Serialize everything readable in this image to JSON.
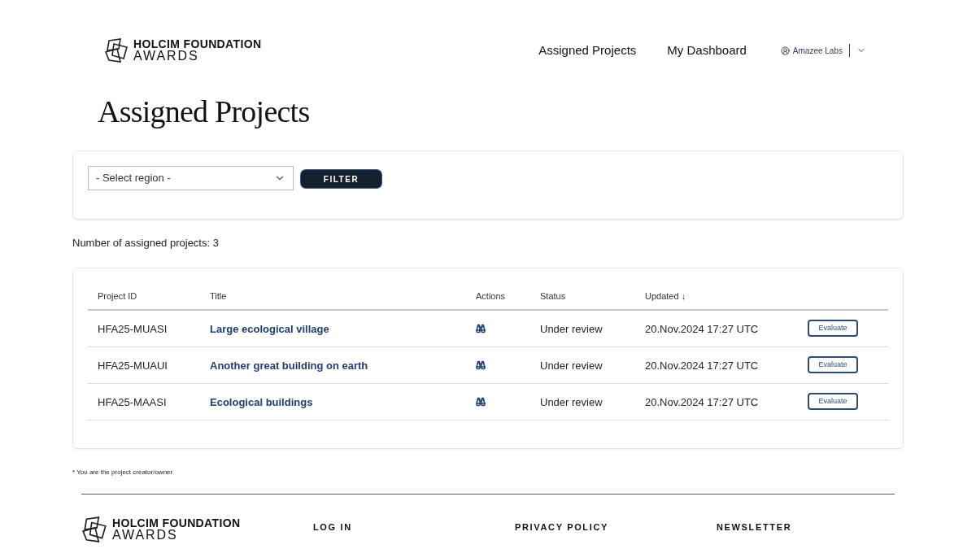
{
  "header": {
    "logo": {
      "line1": "HOLCIM FOUNDATION",
      "line2": "AWARDS"
    },
    "nav": [
      "Assigned Projects",
      "My Dashboard"
    ],
    "user": "Amazee Labs"
  },
  "page_title": "Assigned Projects",
  "filter": {
    "select_placeholder": "- Select region -",
    "button": "FILTER"
  },
  "count_text": "Number of assigned projects: 3",
  "table": {
    "columns": [
      {
        "label": "Project ID"
      },
      {
        "label": "Title"
      },
      {
        "label": "Actions"
      },
      {
        "label": "Status"
      },
      {
        "label": "Updated",
        "sort": "↓"
      }
    ],
    "rows": [
      {
        "id": "HFA25-MUASI",
        "title": "Large ecological village",
        "status": "Under review",
        "updated": "20.Nov.2024 17:27 UTC",
        "action": "Evaluate"
      },
      {
        "id": "HFA25-MUAUI",
        "title": "Another great building on earth",
        "status": "Under review",
        "updated": "20.Nov.2024 17:27 UTC",
        "action": "Evaluate"
      },
      {
        "id": "HFA25-MAASI",
        "title": "Ecological buildings",
        "status": "Under review",
        "updated": "20.Nov.2024 17:27 UTC",
        "action": "Evaluate"
      }
    ]
  },
  "footnote": "* You are the project creator/owner",
  "footer": {
    "logo": {
      "line1": "HOLCIM FOUNDATION",
      "line2": "AWARDS"
    },
    "links": [
      "LOG IN",
      "PRIVACY POLICY",
      "NEWSLETTER"
    ]
  }
}
